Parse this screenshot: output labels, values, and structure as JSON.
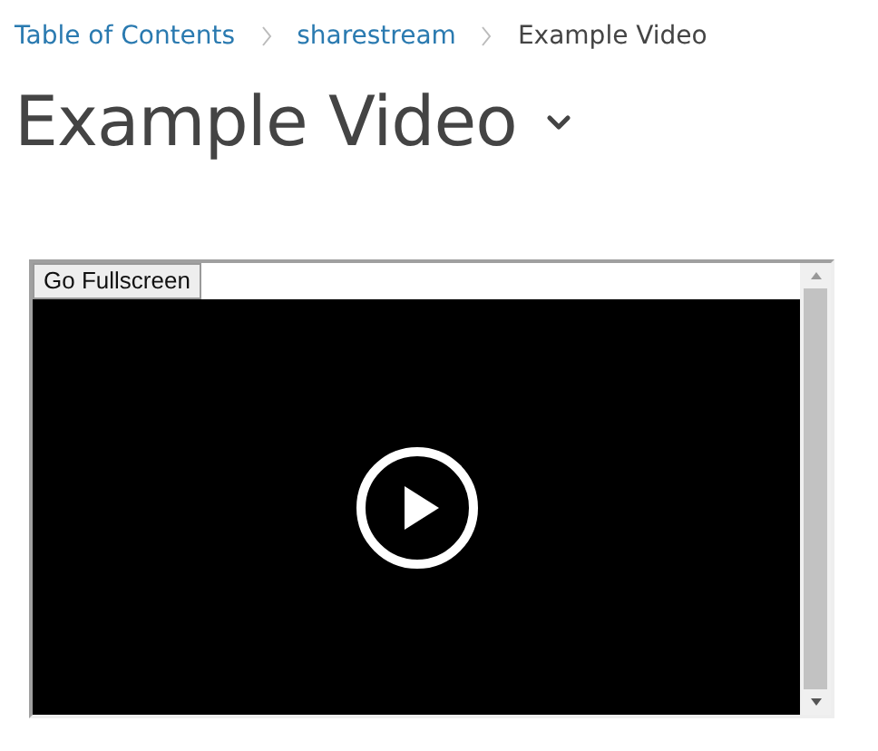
{
  "breadcrumb": [
    {
      "label": "Table of Contents",
      "current": false
    },
    {
      "label": "sharestream",
      "current": false
    },
    {
      "label": "Example Video",
      "current": true
    }
  ],
  "title": "Example Video",
  "player": {
    "button": "Go Fullscreen"
  }
}
